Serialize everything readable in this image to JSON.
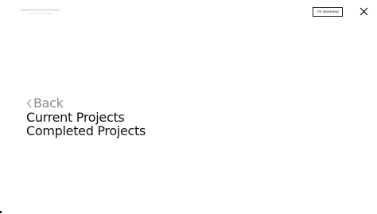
{
  "header": {
    "logo_icon": "logo-wordmark",
    "interested_button_label": "I'm Interested",
    "close_icon": "close-icon"
  },
  "menu": {
    "back_label": "Back",
    "back_icon": "chevron-left-icon",
    "items": [
      {
        "label": "Current Projects"
      },
      {
        "label": "Completed Projects"
      }
    ]
  },
  "colors": {
    "background": "#ffffff",
    "text": "#111111",
    "back_text": "#8a8a8a",
    "logo": "#e6e6e6"
  }
}
